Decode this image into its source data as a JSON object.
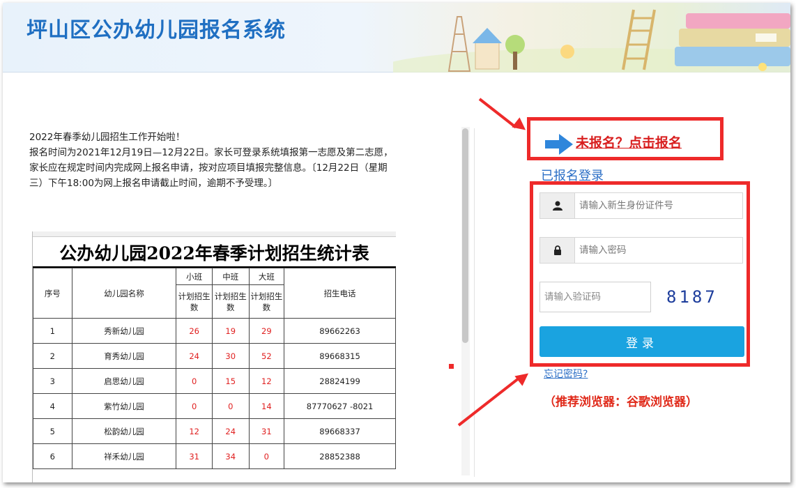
{
  "header": {
    "title": "坪山区公办幼儿园报名系统"
  },
  "notice": {
    "lines": [
      "2022年春季幼儿园招生工作开始啦！",
      "报名时间为2021年12月19日—12月22日。家长可登录系统填报第一志愿及第二志愿，家长应在规定时间内完成网上报名申请，按对应项目填报完整信息。〔12月22日（星期三）下午18:00为网上报名申请截止时间，逾期不予受理。〕"
    ]
  },
  "table": {
    "title": "公办幼儿园2022年春季计划招生统计表",
    "headers": {
      "index": "序号",
      "name": "幼儿园名称",
      "small": "小班",
      "middle": "中班",
      "large": "大班",
      "plan": "计划招生数",
      "phone": "招生电话"
    },
    "rows": [
      {
        "index": "1",
        "name": "秀新幼儿园",
        "small": "26",
        "middle": "19",
        "large": "29",
        "phone": "89662263"
      },
      {
        "index": "2",
        "name": "育秀幼儿园",
        "small": "24",
        "middle": "30",
        "large": "52",
        "phone": "89668315"
      },
      {
        "index": "3",
        "name": "启思幼儿园",
        "small": "0",
        "middle": "15",
        "large": "12",
        "phone": "28824199"
      },
      {
        "index": "4",
        "name": "紫竹幼儿园",
        "small": "0",
        "middle": "0",
        "large": "14",
        "phone": "87770627 -8021"
      },
      {
        "index": "5",
        "name": "松韵幼儿园",
        "small": "12",
        "middle": "24",
        "large": "31",
        "phone": "89668337"
      },
      {
        "index": "6",
        "name": "祥禾幼儿园",
        "small": "31",
        "middle": "34",
        "large": "0",
        "phone": "28852388"
      }
    ]
  },
  "login": {
    "register_link": "未报名？点击报名",
    "heading": "已报名登录",
    "id_placeholder": "请输入新生身份证件号",
    "password_placeholder": "请输入密码",
    "captcha_placeholder": "请输入验证码",
    "captcha_code": "8187",
    "submit_label": "登录",
    "forgot_password": "忘记密码?",
    "browser_recommendation": "（推荐浏览器：谷歌浏览器）"
  },
  "colors": {
    "title_blue": "#1f6fc2",
    "highlight_red": "#ee2a2a",
    "button_blue": "#1aa3e0",
    "link_blue": "#2c6fc6"
  },
  "icons": [
    "user-icon",
    "lock-icon",
    "right-arrow-icon"
  ]
}
